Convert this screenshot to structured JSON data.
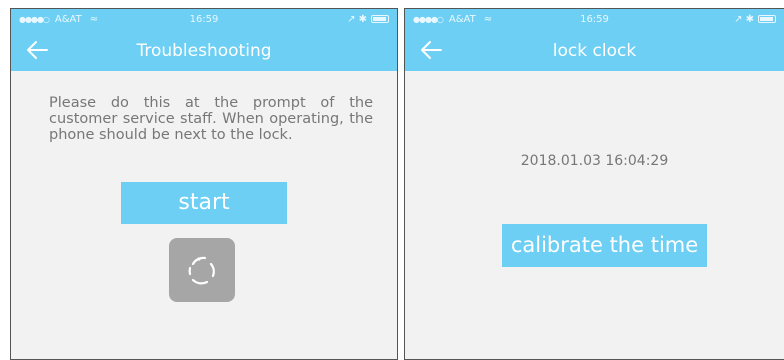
{
  "left_screen": {
    "status": {
      "signal": "●●●●○",
      "carrier": "A&AT",
      "wifi": "≈",
      "time": "16:59",
      "icons": "↗ ✱"
    },
    "header": {
      "back_icon": "arrow-left-icon",
      "title": "Troubleshooting"
    },
    "instructions": "Please do this at the prompt of the customer service staff. When operating, the phone should be next to the lock.",
    "start_label": "start",
    "spinner_icon": "loading-spinner-icon"
  },
  "right_screen": {
    "status": {
      "signal": "●●●●○",
      "carrier": "A&AT",
      "wifi": "≈",
      "time": "16:59",
      "icons": "↗ ✱"
    },
    "header": {
      "back_icon": "arrow-left-icon",
      "title": "lock clock"
    },
    "datetime": "2018.01.03 16:04:29",
    "calibrate_label": "calibrate the time"
  },
  "colors": {
    "accent": "#6dcff3",
    "background": "#f2f2f2",
    "text_gray": "#777777",
    "spinner_bg": "#a6a6a6"
  }
}
